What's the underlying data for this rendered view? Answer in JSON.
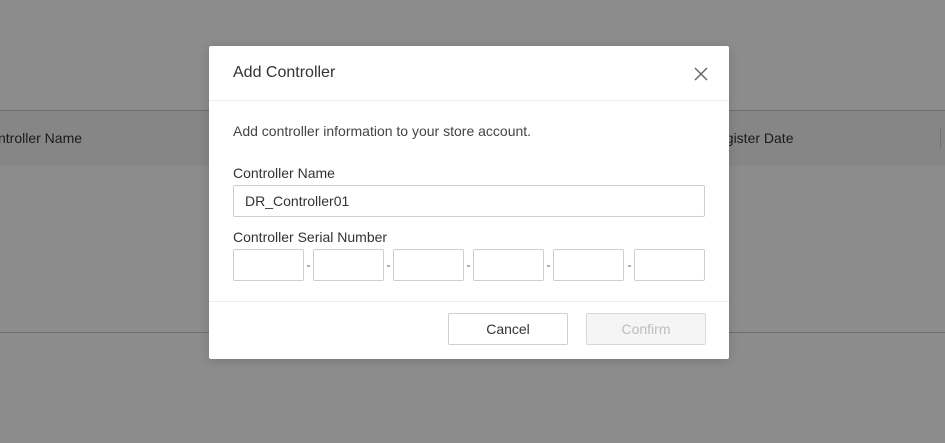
{
  "background_table": {
    "columns": [
      "ntroller Name",
      "egister Date"
    ]
  },
  "modal": {
    "title": "Add Controller",
    "close_icon": "close-icon",
    "description": "Add controller information to your store account.",
    "controller_name": {
      "label": "Controller Name",
      "value": "DR_Controller01"
    },
    "serial_number": {
      "label": "Controller Serial Number",
      "segments": [
        "",
        "",
        "",
        "",
        "",
        ""
      ],
      "separator": "-"
    },
    "buttons": {
      "cancel": "Cancel",
      "confirm": "Confirm"
    }
  },
  "colors": {
    "overlay": "#000000",
    "confirm_disabled_text": "#bdbdbd",
    "border": "#cfcfcf"
  }
}
